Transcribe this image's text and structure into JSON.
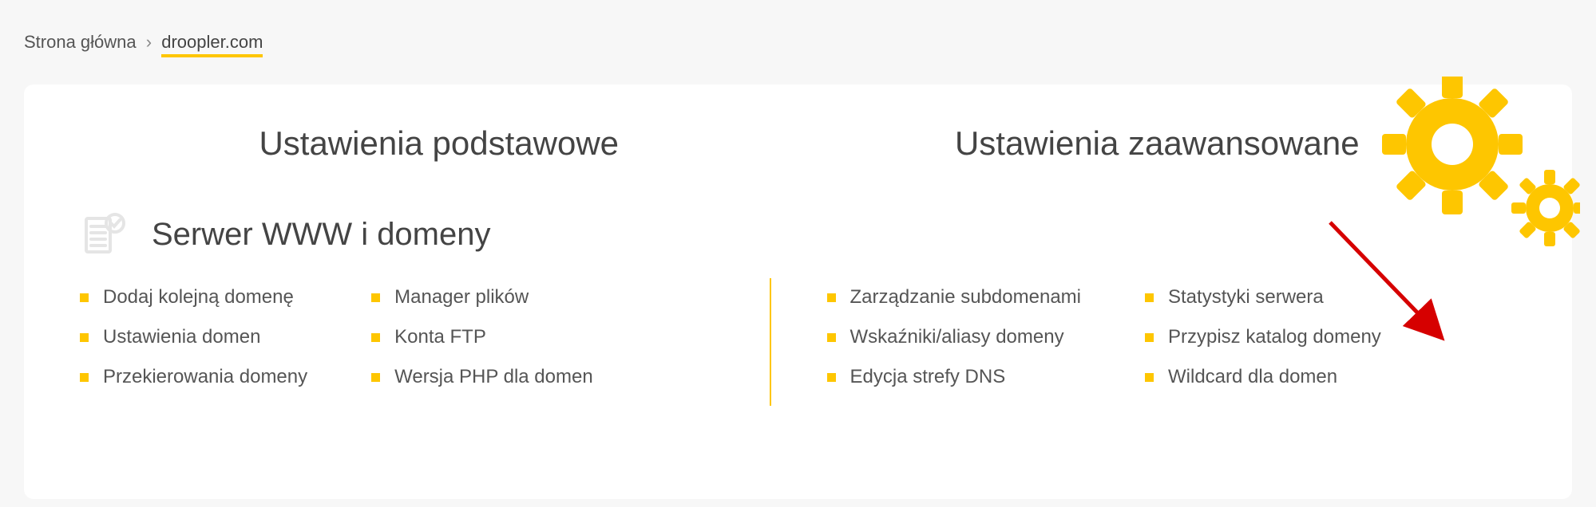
{
  "breadcrumb": {
    "home": "Strona główna",
    "current": "droopler.com"
  },
  "headers": {
    "basic": "Ustawienia podstawowe",
    "advanced": "Ustawienia zaawansowane"
  },
  "section": {
    "title": "Serwer WWW i domeny"
  },
  "basic": {
    "col1": [
      "Dodaj kolejną domenę",
      "Ustawienia domen",
      "Przekierowania domeny"
    ],
    "col2": [
      "Manager plików",
      "Konta FTP",
      "Wersja PHP dla domen"
    ]
  },
  "advanced": {
    "col1": [
      "Zarządzanie subdomenami",
      "Wskaźniki/aliasy domeny",
      "Edycja strefy DNS"
    ],
    "col2": [
      "Statystyki serwera",
      "Przypisz katalog domeny",
      "Wildcard dla domen"
    ]
  }
}
